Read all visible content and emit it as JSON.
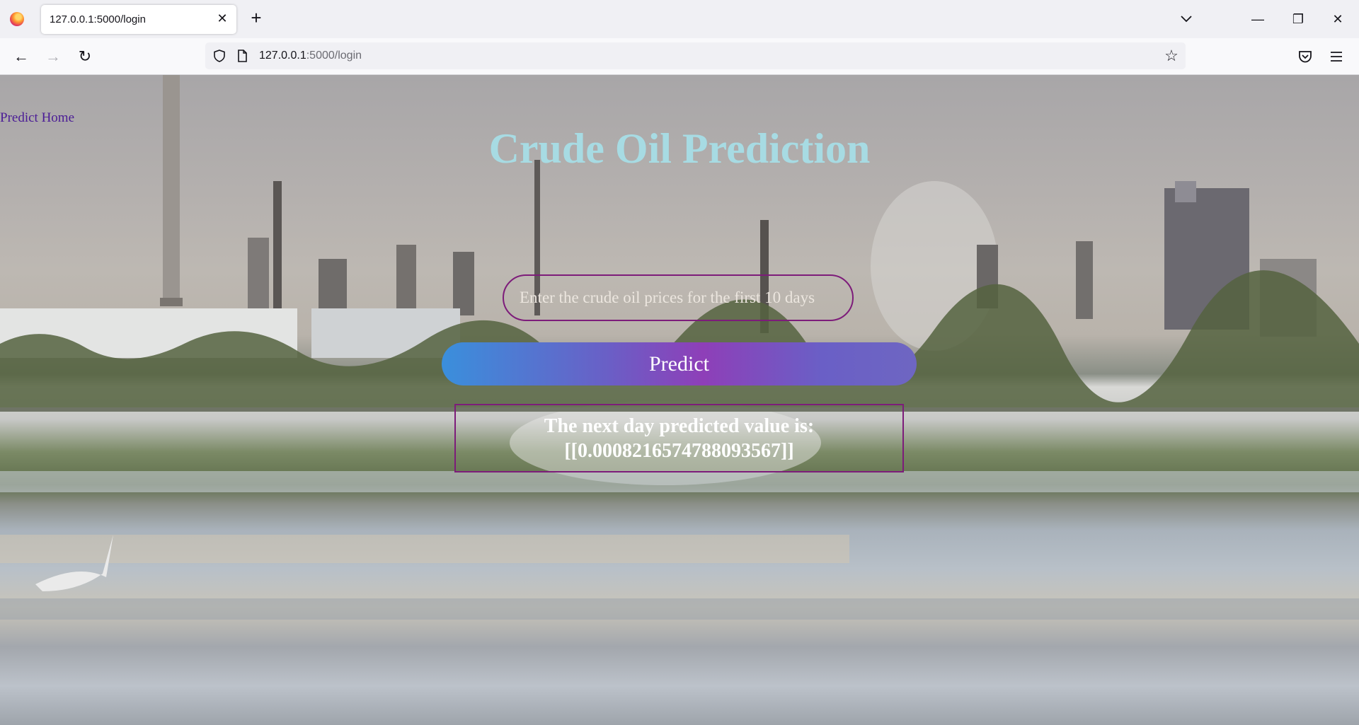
{
  "browser": {
    "tab_title": "127.0.0.1:5000/login",
    "url_host": "127.0.0.1",
    "url_path": ":5000/login"
  },
  "page": {
    "home_link": "Predict Home",
    "title": "Crude Oil Prediction",
    "input_placeholder": "Enter the crude oil prices for the first 10 days",
    "input_value": "",
    "predict_label": "Predict",
    "result_text": "The next day predicted value is:[[0.0008216574788093567]]"
  },
  "colors": {
    "title": "#a7dbe3",
    "accent_border": "#7d1c7a",
    "link": "#4b1c96",
    "button_gradient_start": "#3a8fdc",
    "button_gradient_mid": "#8e3fb8"
  }
}
